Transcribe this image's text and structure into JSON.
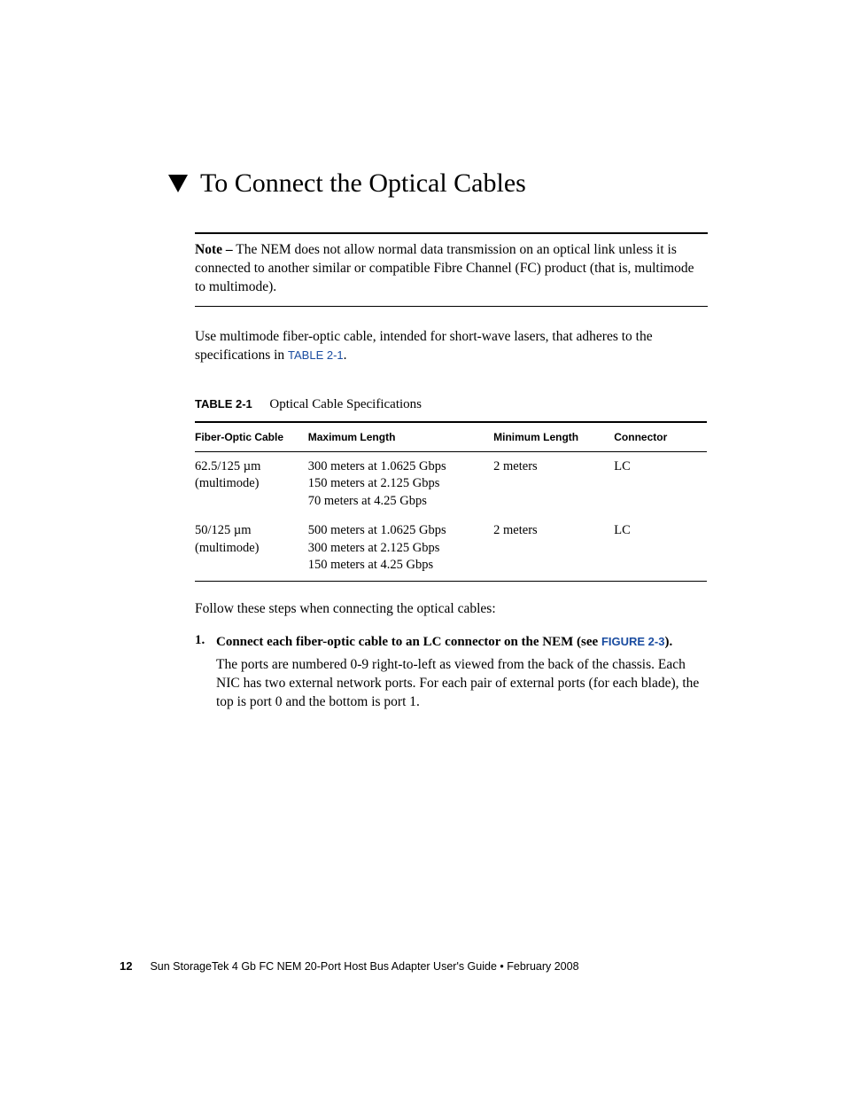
{
  "heading": "To Connect the Optical Cables",
  "note": {
    "label": "Note –",
    "text": " The NEM does not allow normal data transmission on an optical link unless it is connected to another similar or compatible Fibre Channel (FC) product (that is, multimode to multimode)."
  },
  "intro": {
    "before_link": "Use multimode fiber-optic cable, intended for short-wave lasers, that adheres to the specifications in ",
    "link": "TABLE 2-1",
    "after_link": "."
  },
  "table": {
    "caption_label": "TABLE 2-1",
    "caption_title": "Optical Cable Specifications",
    "headers": {
      "cable": "Fiber-Optic Cable",
      "max": "Maximum Length",
      "min": "Minimum Length",
      "conn": "Connector"
    },
    "rows": [
      {
        "cable": "62.5/125 µm (multimode)",
        "max": "300 meters at 1.0625 Gbps\n150 meters at 2.125 Gbps\n70 meters at 4.25 Gbps",
        "min": "2 meters",
        "conn": "LC"
      },
      {
        "cable": "50/125 µm (multimode)",
        "max": "500 meters at 1.0625 Gbps\n300 meters at 2.125 Gbps\n150 meters at 4.25 Gbps",
        "min": "2 meters",
        "conn": "LC"
      }
    ]
  },
  "follow": "Follow these steps when connecting the optical cables:",
  "step": {
    "number": "1.",
    "text_before": "Connect each fiber-optic cable to an LC connector on the NEM (see ",
    "link": "FIGURE 2-3",
    "text_after": ").",
    "body": "The ports are numbered 0-9 right-to-left as viewed from the back of the chassis. Each NIC has two external network ports. For each pair of external ports (for each blade), the top is port 0 and the bottom is port 1."
  },
  "footer": {
    "page": "12",
    "text": "Sun StorageTek 4 Gb FC NEM 20-Port Host Bus Adapter User's Guide • February 2008"
  }
}
